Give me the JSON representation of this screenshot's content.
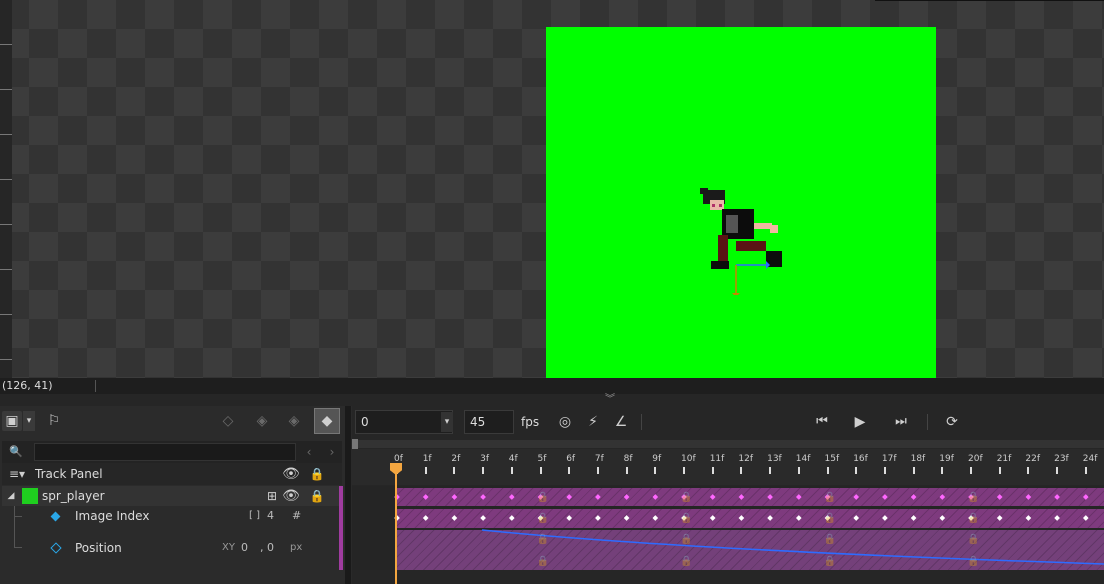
{
  "viewport": {
    "coords": "(126, 41)",
    "stage_color": "#00ff00"
  },
  "toolbar_left": {
    "icons": [
      "display-icon",
      "dropdown-icon",
      "flag-icon",
      "key-prev-icon",
      "key-remove-icon",
      "key-add-icon",
      "key-auto-icon"
    ]
  },
  "playback": {
    "frame_value": "0",
    "fps_value": "45",
    "fps_label": "fps"
  },
  "track_panel": {
    "search_placeholder": "",
    "title": "Track Panel",
    "sprite_name": "spr_player",
    "rows": [
      {
        "label": "Image Index",
        "prefix": "[ ]",
        "value": "4",
        "unit": "#"
      },
      {
        "label": "Position",
        "prefix": "XY",
        "x": "0",
        "y": "0",
        "sep": ",",
        "unit": "px"
      }
    ]
  },
  "timeline": {
    "frames": [
      "0f",
      "1f",
      "2f",
      "3f",
      "4f",
      "5f",
      "6f",
      "7f",
      "8f",
      "9f",
      "10f",
      "11f",
      "12f",
      "13f",
      "14f",
      "15f",
      "16f",
      "17f",
      "18f",
      "19f",
      "20f",
      "21f",
      "22f",
      "23f",
      "24f"
    ],
    "current_frame": 0,
    "accent_color": "#a03ca0",
    "playhead_color": "#f4a640"
  }
}
